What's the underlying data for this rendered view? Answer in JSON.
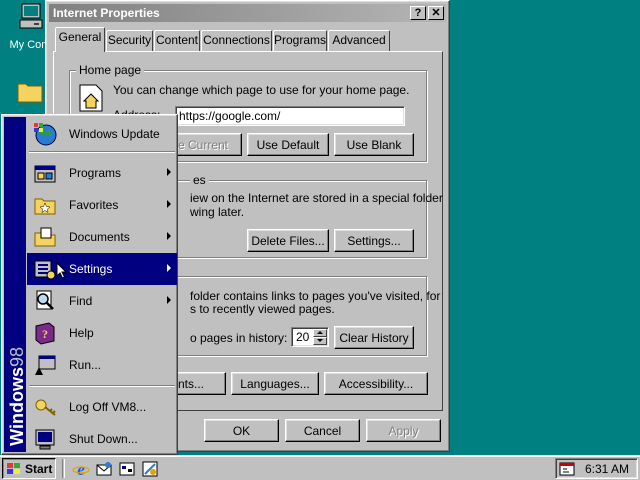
{
  "desktop": {
    "my_computer_label": "My Com"
  },
  "dialog": {
    "title": "Internet Properties",
    "help_btn": "?",
    "close_btn": "✕",
    "tabs": [
      "General",
      "Security",
      "Content",
      "Connections",
      "Programs",
      "Advanced"
    ],
    "active_tab": "General",
    "home_page": {
      "group_label": "Home page",
      "description": "You can change which page to use for your home page.",
      "address_label": "Address:",
      "address_value": "https://google.com/",
      "use_current": "Use Current",
      "use_current_visible": "se Current",
      "use_default": "Use Default",
      "use_blank": "Use Blank"
    },
    "temp_files": {
      "group_label_visible": "es",
      "line1_visible": "iew on the Internet are stored in a special folder",
      "line2_visible": "wing later.",
      "delete_files": "Delete Files...",
      "settings": "Settings..."
    },
    "history": {
      "line1_visible": "folder contains links to pages you've visited, for",
      "line2_visible": "s to recently viewed pages.",
      "days_label_visible": "o pages in history:",
      "days_value": "20",
      "clear_history": "Clear History"
    },
    "bottom_buttons": {
      "colors_visible": "",
      "fonts_visible": "Fonts...",
      "languages": "Languages...",
      "accessibility": "Accessibility..."
    },
    "ok": "OK",
    "cancel": "Cancel",
    "apply": "Apply"
  },
  "start_menu": {
    "sidebar_bold": "Windows",
    "sidebar_light": "98",
    "items": [
      {
        "label": "Windows Update",
        "icon": "windows-update-icon",
        "submenu": false
      },
      {
        "label": "Programs",
        "icon": "programs-icon",
        "submenu": true
      },
      {
        "label": "Favorites",
        "icon": "favorites-icon",
        "submenu": true
      },
      {
        "label": "Documents",
        "icon": "documents-icon",
        "submenu": true
      },
      {
        "label": "Settings",
        "icon": "settings-icon",
        "submenu": true,
        "highlighted": true
      },
      {
        "label": "Find",
        "icon": "find-icon",
        "submenu": true
      },
      {
        "label": "Help",
        "icon": "help-icon",
        "submenu": false
      },
      {
        "label": "Run...",
        "icon": "run-icon",
        "submenu": false
      },
      {
        "label": "Log Off VM8...",
        "icon": "logoff-icon",
        "submenu": false
      },
      {
        "label": "Shut Down...",
        "icon": "shutdown-icon",
        "submenu": false
      }
    ]
  },
  "taskbar": {
    "start_label": "Start",
    "clock": "6:31 AM",
    "quick_launch": [
      "ie-icon",
      "outlook-express-icon",
      "show-desktop-icon",
      "channels-icon"
    ]
  },
  "colors": {
    "desktop": "#008080",
    "face": "#c0c0c0",
    "highlight": "#000080",
    "inactive_title_start": "#808080",
    "inactive_title_end": "#b5b5b5"
  }
}
